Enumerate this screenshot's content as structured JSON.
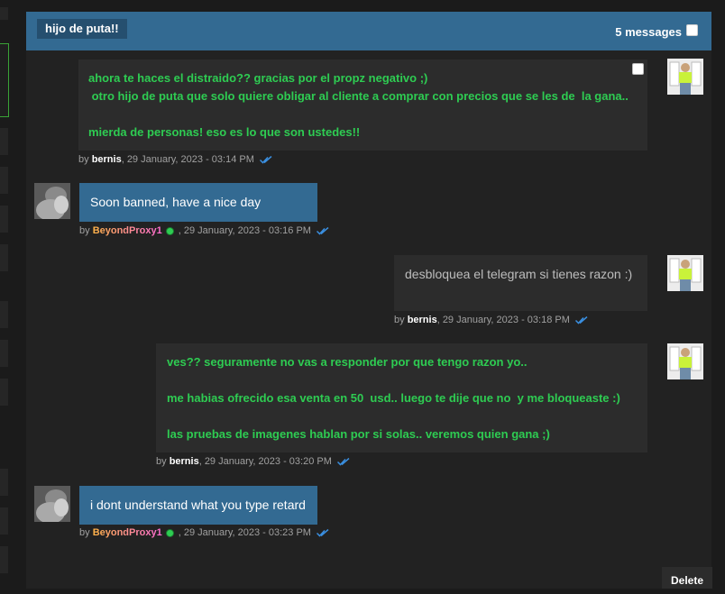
{
  "conversation": {
    "title": "hijo de puta!!",
    "message_count": "5 messages"
  },
  "messages": [
    {
      "author": "bernis",
      "lines": [
        "ahora te haces el distraido?? gracias por el propz negativo ;)",
        " otro hijo de puta que solo quiere obligar al cliente a comprar con precios que se les de  la gana..",
        "",
        "mierda de personas! eso es lo que son ustedes!!"
      ],
      "meta_prefix": "by ",
      "meta_time": ", 29 January, 2023 - 03:14 PM"
    },
    {
      "author": "BeyondProxy1",
      "lines": [
        "Soon banned, have a nice day"
      ],
      "meta_prefix": "by ",
      "meta_time": " , 29 January, 2023 - 03:16 PM"
    },
    {
      "author": "bernis",
      "lines": [
        "desbloquea el telegram si tienes razon :)"
      ],
      "meta_prefix": "by ",
      "meta_time": ", 29 January, 2023 - 03:18 PM"
    },
    {
      "author": "bernis",
      "lines": [
        "ves?? seguramente no vas a responder por que tengo razon yo..",
        "",
        "me habias ofrecido esa venta en 50  usd.. luego te dije que no  y me bloqueaste :)",
        "",
        "las pruebas de imagenes hablan por si solas.. veremos quien gana ;)"
      ],
      "meta_prefix": "by ",
      "meta_time": ", 29 January, 2023 - 03:20 PM"
    },
    {
      "author": "BeyondProxy1",
      "lines": [
        "i dont understand what you type retard"
      ],
      "meta_prefix": "by ",
      "meta_time": " , 29 January, 2023 - 03:23 PM"
    }
  ],
  "actions": {
    "delete_label": "Delete"
  },
  "icons": {
    "read_receipt": "double-check-icon",
    "online_status": "online-dot-icon",
    "select": "checkbox-icon"
  },
  "colors": {
    "header_bg": "#336a92",
    "title_tag_bg": "#254f6f",
    "own_message_text": "#2ecc52",
    "read_receipt": "#3a8fe0",
    "online": "#2ecc52"
  }
}
